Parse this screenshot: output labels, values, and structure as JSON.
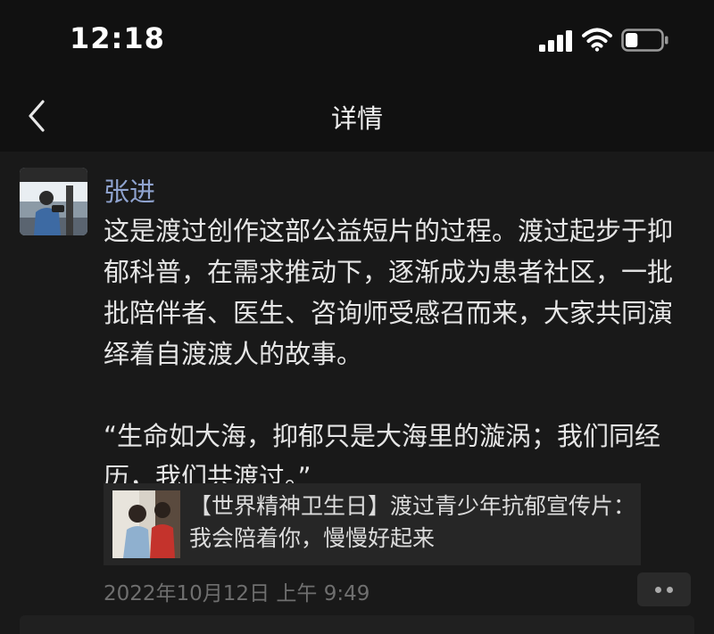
{
  "status_bar": {
    "time": "12:18",
    "signal_icon": "cellular-signal-icon",
    "wifi_icon": "wifi-icon",
    "battery_icon": "battery-icon",
    "battery_level": 0.35
  },
  "nav": {
    "title": "详情",
    "back_icon": "chevron-left-icon"
  },
  "post": {
    "author": "张进",
    "paragraph1": "这是渡过创作这部公益短片的过程。渡过起步于抑郁科普，在需求推动下，逐渐成为患者社区，一批批陪伴者、医生、咨询师受感召而来，大家共同演绎着自渡渡人的故事。",
    "paragraph2": "“生命如大海，抑郁只是大海里的漩涡；我们同经历，我们共渡过。”",
    "link": {
      "title": "【世界精神卫生日】渡过青少年抗郁宣传片：我会陪着你，慢慢好起来"
    },
    "timestamp": "2022年10月12日 上午 9:49",
    "more_icon": "more-dots-icon"
  },
  "colors": {
    "background": "#111111",
    "card": "#191919",
    "author_link": "#8fa3cf",
    "timestamp": "#6f6f6f"
  }
}
